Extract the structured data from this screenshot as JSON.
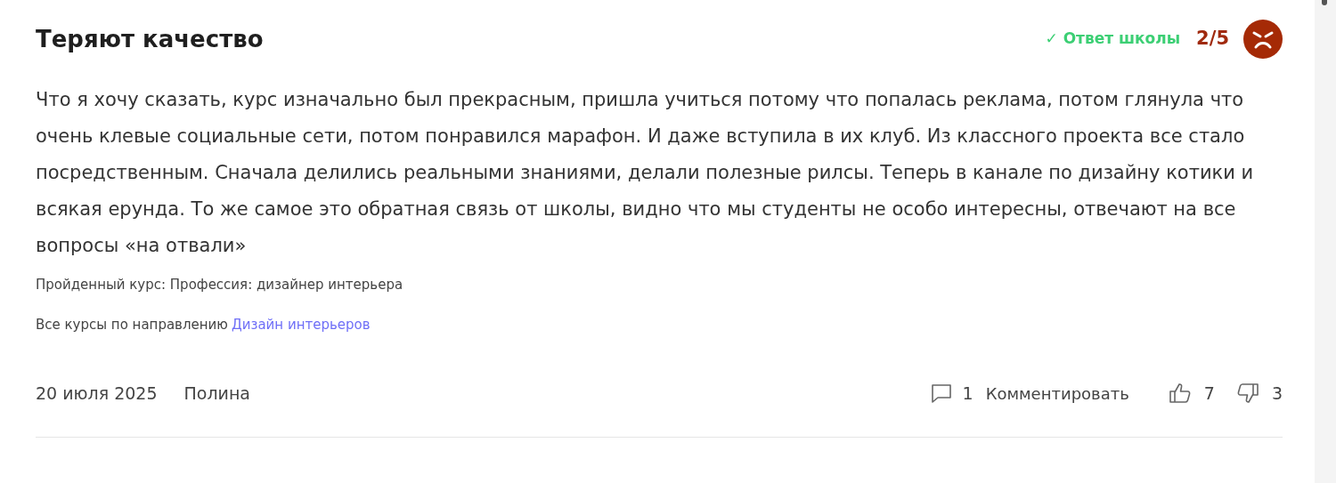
{
  "review": {
    "title": "Теряют качество",
    "school_answer": "✓ Ответ школы",
    "rating": "2/5",
    "body": "Что я хочу сказать, курс изначально был прекрасным, пришла учиться потому что попалась реклама, потом глянула что очень клевые социальные сети, потом понравился марафон. И даже вступила в их клуб. Из классного проекта все стало посредственным. Сначала делились реальными знаниями, делали полезные рилсы. Теперь в канале по дизайну котики и всякая ерунда. То же самое это обратная связь от школы, видно что мы студенты не особо интересны, отвечают на все вопросы «на отвали»",
    "course": "Пройденный курс: Профессия: дизайнер интерьера",
    "direction_label": "Все курсы по направлению",
    "direction_link": "Дизайн интерьеров",
    "date": "20 июля 2025",
    "author": "Полина",
    "comments_count": "1",
    "comment_action": "Комментировать",
    "likes": "7",
    "dislikes": "3"
  }
}
